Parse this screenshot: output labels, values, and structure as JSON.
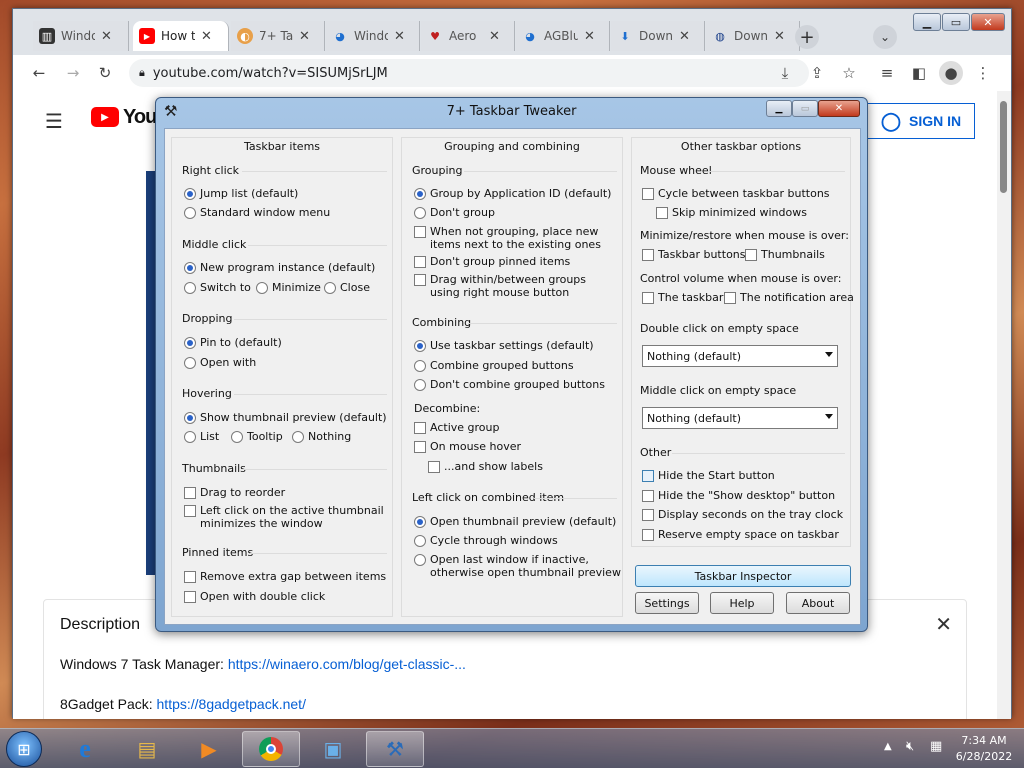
{
  "browser": {
    "tabs": [
      {
        "title": "Windo",
        "icon": "bank-icon"
      },
      {
        "title": "How t",
        "icon": "youtube-icon"
      },
      {
        "title": "7+ Ta",
        "icon": "tweaker-icon"
      },
      {
        "title": "Windo",
        "icon": "edge-icon"
      },
      {
        "title": "Aero",
        "icon": "aero-icon"
      },
      {
        "title": "AGBlu",
        "icon": "edge-icon"
      },
      {
        "title": "Down",
        "icon": "download-icon"
      },
      {
        "title": "Down",
        "icon": "globe-icon"
      }
    ],
    "url": "youtube.com/watch?v=SISUMjSrLJM"
  },
  "youtube": {
    "sign_in": "SIGN IN",
    "logo_text": "YouTu",
    "description_title": "Description",
    "desc_line1_prefix": "Windows 7 Task Manager: ",
    "desc_line1_link": "https://winaero.com/blog/get-classic-...",
    "desc_line2_prefix": "8Gadget Pack: ",
    "desc_line2_link": "https://8gadgetpack.net/"
  },
  "dialog": {
    "title": "7+ Taskbar Tweaker",
    "col1": {
      "header": "Taskbar items",
      "right_click": "Right click",
      "jump_list": "Jump list (default)",
      "standard_menu": "Standard window menu",
      "middle_click": "Middle click",
      "new_instance": "New program instance (default)",
      "switch_to": "Switch to",
      "minimize": "Minimize",
      "close": "Close",
      "dropping": "Dropping",
      "pin_to": "Pin to (default)",
      "open_with": "Open with",
      "hovering": "Hovering",
      "show_thumb": "Show thumbnail preview (default)",
      "list": "List",
      "tooltip": "Tooltip",
      "nothing": "Nothing",
      "thumbnails": "Thumbnails",
      "drag_reorder": "Drag to reorder",
      "left_click_active_1": "Left click on the active thumbnail",
      "left_click_active_2": "minimizes the window",
      "pinned_items": "Pinned items",
      "remove_gap": "Remove extra gap between items",
      "open_double": "Open with double click"
    },
    "col2": {
      "header": "Grouping and combining",
      "grouping": "Grouping",
      "group_by_id": "Group by Application ID (default)",
      "dont_group": "Don't group",
      "when_not_1": "When not grouping, place new",
      "when_not_2": "items next to the existing ones",
      "dont_group_pinned": "Don't group pinned items",
      "drag_within_1": "Drag within/between groups",
      "drag_within_2": "using right mouse button",
      "combining": "Combining",
      "use_taskbar": "Use taskbar settings (default)",
      "combine_grouped": "Combine grouped buttons",
      "dont_combine": "Don't combine grouped buttons",
      "decombine": "Decombine:",
      "active_group": "Active group",
      "on_mouse_hover": "On mouse hover",
      "and_show_labels": "...and show labels",
      "left_click_combined": "Left click on combined item",
      "open_thumb_preview": "Open thumbnail preview (default)",
      "cycle_windows": "Cycle through windows",
      "open_last_1": "Open last window if inactive,",
      "open_last_2": "otherwise open thumbnail preview"
    },
    "col3": {
      "header": "Other taskbar options",
      "mouse_wheel": "Mouse wheel",
      "cycle_buttons": "Cycle between taskbar buttons",
      "skip_minimized": "Skip minimized windows",
      "min_restore": "Minimize/restore when mouse is over:",
      "taskbar_buttons": "Taskbar buttons",
      "thumbnails": "Thumbnails",
      "control_volume": "Control volume when mouse is over:",
      "the_taskbar": "The taskbar",
      "notification_area": "The notification area",
      "double_click_empty": "Double click on empty space",
      "double_click_value": "Nothing (default)",
      "middle_click_empty": "Middle click on empty space",
      "middle_click_value": "Nothing (default)",
      "other": "Other",
      "hide_start": "Hide the Start button",
      "hide_show_desktop": "Hide the \"Show desktop\" button",
      "display_seconds": "Display seconds on the tray clock",
      "reserve_space": "Reserve empty space on taskbar"
    },
    "buttons": {
      "inspector": "Taskbar Inspector",
      "settings": "Settings",
      "help": "Help",
      "about": "About"
    }
  },
  "taskbar": {
    "time": "7:34 AM",
    "date": "6/28/2022"
  }
}
